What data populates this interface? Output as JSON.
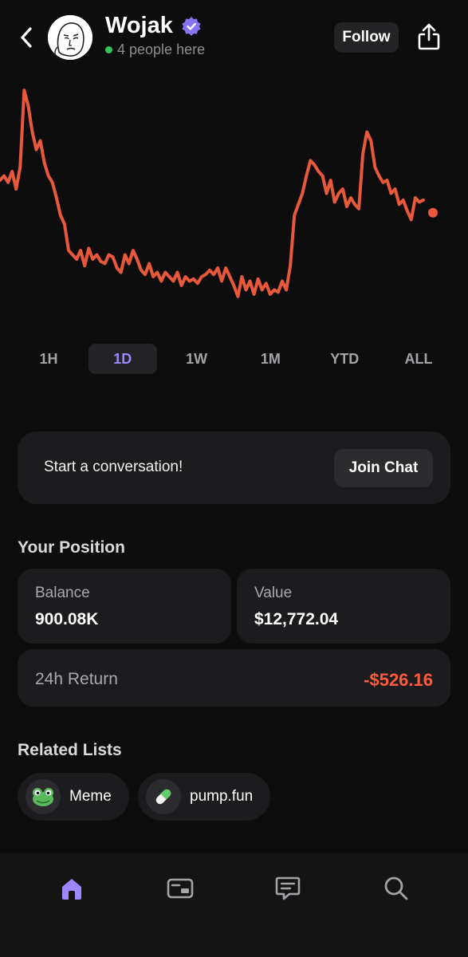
{
  "header": {
    "title": "Wojak",
    "online_text": "4 people here",
    "follow_label": "Follow",
    "icons": {
      "back": "chevron-left-icon",
      "verified": "verified-badge-icon",
      "share": "share-icon"
    }
  },
  "colors": {
    "accent": "#9d86ff",
    "chart_line": "#e8583a",
    "negative": "#ff5a3c",
    "online": "#34c759"
  },
  "chart_data": {
    "type": "line",
    "title": "",
    "xlabel": "",
    "ylabel": "",
    "x": [
      0,
      1,
      2,
      3,
      4,
      5,
      6,
      7,
      8,
      9,
      10,
      11,
      12,
      13,
      14,
      15,
      16,
      17,
      18,
      19,
      20,
      21,
      22,
      23,
      24,
      25,
      26,
      27,
      28,
      29,
      30,
      31,
      32,
      33,
      34,
      35,
      36,
      37,
      38,
      39,
      40,
      41,
      42,
      43,
      44,
      45,
      46,
      47,
      48,
      49,
      50,
      51,
      52,
      53,
      54,
      55,
      56,
      57,
      58,
      59,
      60,
      61,
      62,
      63,
      64,
      65,
      66,
      67,
      68,
      69,
      70,
      71,
      72,
      73,
      74,
      75,
      76,
      77,
      78,
      79,
      80,
      81,
      82,
      83,
      84,
      85,
      86,
      87,
      88,
      89,
      90,
      91,
      92,
      93,
      94,
      95,
      96,
      97,
      98,
      99,
      100,
      101,
      102,
      103,
      104,
      105
    ],
    "series": [
      {
        "values": [
          0.56,
          0.58,
          0.55,
          0.6,
          0.52,
          0.62,
          0.97,
          0.9,
          0.78,
          0.7,
          0.74,
          0.64,
          0.58,
          0.55,
          0.48,
          0.4,
          0.36,
          0.24,
          0.22,
          0.2,
          0.24,
          0.17,
          0.25,
          0.2,
          0.22,
          0.19,
          0.18,
          0.22,
          0.21,
          0.16,
          0.14,
          0.22,
          0.18,
          0.24,
          0.2,
          0.15,
          0.13,
          0.18,
          0.12,
          0.14,
          0.1,
          0.14,
          0.12,
          0.1,
          0.14,
          0.08,
          0.12,
          0.1,
          0.11,
          0.09,
          0.12,
          0.13,
          0.15,
          0.13,
          0.16,
          0.1,
          0.16,
          0.12,
          0.08,
          0.03,
          0.12,
          0.06,
          0.1,
          0.04,
          0.11,
          0.06,
          0.09,
          0.04,
          0.06,
          0.05,
          0.1,
          0.06,
          0.17,
          0.4,
          0.45,
          0.5,
          0.58,
          0.65,
          0.63,
          0.6,
          0.58,
          0.5,
          0.56,
          0.46,
          0.5,
          0.52,
          0.44,
          0.48,
          0.45,
          0.43,
          0.68,
          0.78,
          0.74,
          0.62,
          0.58,
          0.55,
          0.56,
          0.5,
          0.52,
          0.45,
          0.47,
          0.42,
          0.38,
          0.48,
          0.46,
          0.47
        ]
      }
    ],
    "ylim": [
      0,
      1
    ],
    "grid": false,
    "legend": "none"
  },
  "ranges": [
    {
      "label": "1H",
      "active": false
    },
    {
      "label": "1D",
      "active": true
    },
    {
      "label": "1W",
      "active": false
    },
    {
      "label": "1M",
      "active": false
    },
    {
      "label": "YTD",
      "active": false
    },
    {
      "label": "ALL",
      "active": false
    }
  ],
  "conversation": {
    "prompt": "Start a conversation!",
    "join_label": "Join Chat"
  },
  "position": {
    "title": "Your Position",
    "balance_label": "Balance",
    "balance_value": "900.08K",
    "value_label": "Value",
    "value_value": "$12,772.04",
    "return_label": "24h Return",
    "return_value": "-$526.16"
  },
  "related": {
    "title": "Related Lists",
    "items": [
      {
        "label": "Meme",
        "icon": "frog-icon"
      },
      {
        "label": "pump.fun",
        "icon": "pill-icon"
      }
    ]
  },
  "tabbar": {
    "items": [
      {
        "icon": "home-icon",
        "active": true
      },
      {
        "icon": "wallet-card-icon",
        "active": false
      },
      {
        "icon": "chat-icon",
        "active": false
      },
      {
        "icon": "search-icon",
        "active": false
      }
    ]
  }
}
